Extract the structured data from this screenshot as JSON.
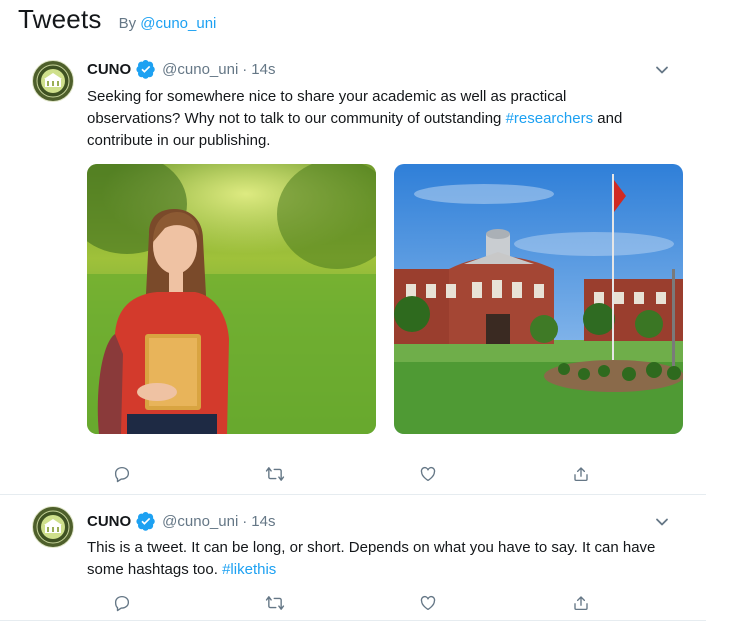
{
  "header": {
    "title": "Tweets",
    "by_prefix": "By ",
    "by_handle": "@cuno_uni"
  },
  "tweets": [
    {
      "name": "CUNO",
      "handle": "@cuno_uni",
      "separator": "·",
      "time": "14s",
      "text_before": "Seeking for somewhere nice to share your academic as well as practical observations? Why not to talk to our community of outstanding ",
      "hashtag": "#researchers",
      "text_after": " and contribute in our publishing.",
      "media": [
        "student-photo",
        "campus-building-photo"
      ]
    },
    {
      "name": "CUNO",
      "handle": "@cuno_uni",
      "separator": "·",
      "time": "14s",
      "text_before": "This is a tweet. It can be long, or short. Depends on what you have to say. It can have some hashtags too. ",
      "hashtag": "#likethis",
      "text_after": ""
    }
  ],
  "colors": {
    "accent": "#1da1f2",
    "muted": "#657786",
    "text": "#14171a",
    "border": "#e6ecf0"
  },
  "icons": {
    "reply": "reply-icon",
    "retweet": "retweet-icon",
    "like": "like-icon",
    "share": "share-icon",
    "verified": "verified-badge-icon",
    "menu": "chevron-down-icon"
  }
}
